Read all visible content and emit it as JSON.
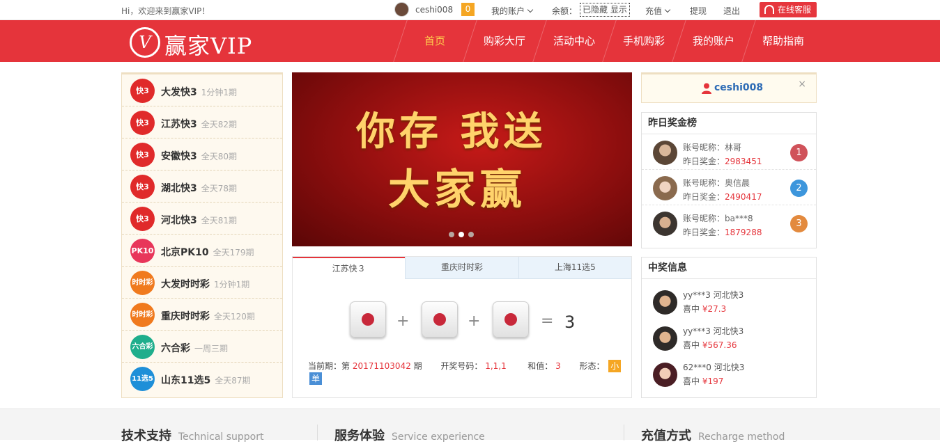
{
  "topbar": {
    "greeting": "Hi，欢迎来到赢家VIP！",
    "username": "ceshi008",
    "message_count": "0",
    "my_account": "我的账户",
    "balance_label": "余额：",
    "balance_hidden": "已隐藏 显示",
    "recharge": "充值",
    "withdraw": "提现",
    "logout": "退出",
    "online_service": "在线客服"
  },
  "nav": {
    "logo_mark": "V",
    "logo_text": "赢家VIP",
    "items": [
      {
        "label": "首页"
      },
      {
        "label": "购彩大厅"
      },
      {
        "label": "活动中心"
      },
      {
        "label": "手机购彩"
      },
      {
        "label": "我的账户"
      },
      {
        "label": "帮助指南"
      }
    ]
  },
  "games": [
    {
      "name": "大发快3",
      "sub": "1分钟1期",
      "icon": "快3",
      "color": "#e02a2a"
    },
    {
      "name": "江苏快3",
      "sub": "全天82期",
      "icon": "快3",
      "color": "#e02a2a"
    },
    {
      "name": "安徽快3",
      "sub": "全天80期",
      "icon": "快3",
      "color": "#e02a2a"
    },
    {
      "name": "湖北快3",
      "sub": "全天78期",
      "icon": "快3",
      "color": "#e02a2a"
    },
    {
      "name": "河北快3",
      "sub": "全天81期",
      "icon": "快3",
      "color": "#e02a2a"
    },
    {
      "name": "北京PK10",
      "sub": "全天179期",
      "icon": "PK10",
      "color": "#e8365a"
    },
    {
      "name": "大发时时彩",
      "sub": "1分钟1期",
      "icon": "时时彩",
      "color": "#f07a1e"
    },
    {
      "name": "重庆时时彩",
      "sub": "全天120期",
      "icon": "时时彩",
      "color": "#f07a1e"
    },
    {
      "name": "六合彩",
      "sub": "一周三期",
      "icon": "六合彩",
      "color": "#1fae8c"
    },
    {
      "name": "山东11选5",
      "sub": "全天87期",
      "icon": "11选5",
      "color": "#1e8fd8"
    }
  ],
  "banner": {
    "line1": "你存  我送",
    "line2": "大家赢",
    "slides": 3,
    "active_slide": 2
  },
  "lottery": {
    "tabs": [
      {
        "label": "江苏快３"
      },
      {
        "label": "重庆时时彩"
      },
      {
        "label": "上海11选5"
      }
    ],
    "plus": "+",
    "equals": "=",
    "sum_result": "3",
    "period_label": "当前期：第",
    "period": "20171103042",
    "period_suffix": "期",
    "numbers_label": "开奖号码：",
    "numbers": "1,1,1",
    "sum_label": "和值：",
    "sum": "3",
    "shape_label": "形态：",
    "shape_small": "小",
    "shape_odd": "单"
  },
  "user": {
    "name": "ceshi008",
    "close": "×"
  },
  "leaderboard": {
    "title": "昨日奖金榜",
    "nick_label": "账号昵称：",
    "prize_label": "昨日奖金：",
    "rows": [
      {
        "nick": "林哥",
        "prize": "2983451",
        "rank": "1",
        "color": "#d0525a"
      },
      {
        "nick": "奥信晨",
        "prize": "2490417",
        "rank": "2",
        "color": "#3d96dc"
      },
      {
        "nick": "ba***8",
        "prize": "1879288",
        "rank": "3",
        "color": "#e38a3e"
      }
    ]
  },
  "wins": {
    "title": "中奖信息",
    "win_label": "喜中",
    "rows": [
      {
        "user_game": "yy***3 河北快3",
        "amount": "¥27.3"
      },
      {
        "user_game": "yy***3 河北快3",
        "amount": "¥567.36"
      },
      {
        "user_game": "62***0 河北快3",
        "amount": "¥197"
      }
    ]
  },
  "footer": {
    "col1": "技术支持",
    "col1_en": "Technical support",
    "col2": "服务体验",
    "col2_en": "Service experience",
    "col3": "充值方式",
    "col3_en": "Recharge method"
  }
}
